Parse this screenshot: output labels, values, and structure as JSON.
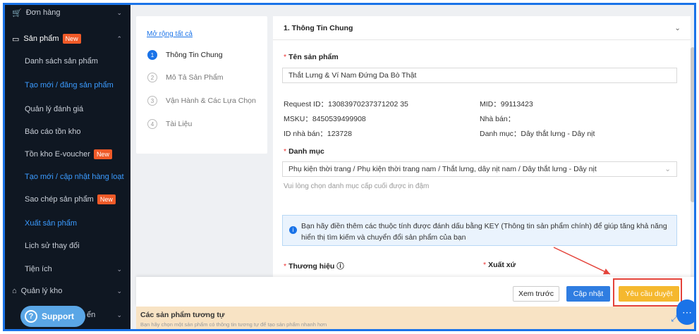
{
  "sidebar": {
    "orders": "Đơn hàng",
    "products": "Sản phẩm",
    "products_badge": "New",
    "items": [
      {
        "label": "Danh sách sản phẩm"
      },
      {
        "label": "Tạo mới / đăng sản phẩm"
      },
      {
        "label": "Quản lý đánh giá"
      },
      {
        "label": "Báo cáo tồn kho"
      },
      {
        "label": "Tồn kho E-voucher",
        "badge": "New"
      },
      {
        "label": "Tạo mới / cập nhật hàng loạt"
      },
      {
        "label": "Sao chép sản phẩm",
        "badge": "New"
      },
      {
        "label": "Xuất sản phẩm"
      },
      {
        "label": "Lịch sử thay đổi"
      },
      {
        "label": "Tiện ích"
      }
    ],
    "warehouse": "Quản lý kho",
    "partial": "ển",
    "support": "Support"
  },
  "steps": {
    "expand_all": "Mở rộng tất cả",
    "items": [
      {
        "num": "1",
        "label": "Thông Tin Chung"
      },
      {
        "num": "2",
        "label": "Mô Tả Sản Phẩm"
      },
      {
        "num": "3",
        "label": "Vận Hành & Các Lựa Chọn"
      },
      {
        "num": "4",
        "label": "Tài Liệu"
      }
    ]
  },
  "form": {
    "section_title": "1. Thông Tin Chung",
    "name_label": "Tên sản phẩm",
    "name_value": "Thắt Lưng & Ví Nam Đứng Da Bò Thật",
    "request_id": "Request ID：13083970237371202 35",
    "msku": "MSKU：8450539499908",
    "seller_id": "ID nhà bán：123728",
    "mid": "MID：99113423",
    "seller": "Nhà bán：",
    "category_meta": "Danh mục：Dây thắt lưng - Dây nịt",
    "category_label": "Danh mục",
    "category_value": "Phụ kiện thời trang / Phụ kiện thời trang nam / Thắt lưng, dây nịt nam / Dây thắt lưng - Dây nịt",
    "category_hint": "Vui lòng chọn danh mục cấp cuối được in đậm",
    "info_text": "Bạn hãy điền thêm các thuộc tính được đánh dấu bằng KEY (Thông tin sản phẩm chính) để giúp tăng khả năng hiển thị tìm kiếm và chuyển đổi sản phẩm của bạn",
    "brand_label": "Thương hiệu",
    "origin_label": "Xuất xứ"
  },
  "actions": {
    "preview": "Xem trước",
    "update": "Cập nhật",
    "approve": "Yêu cầu duyệt"
  },
  "similar": {
    "title": "Các sản phẩm tương tự",
    "subtitle": "Bạn hãy chọn một sản phẩm có thông tin tương tự để tạo sản phẩm nhanh hơn"
  },
  "colors": {
    "accent": "#1a73e8",
    "approve": "#f5b82e",
    "highlight": "#e4433a",
    "badge": "#f05a28"
  }
}
